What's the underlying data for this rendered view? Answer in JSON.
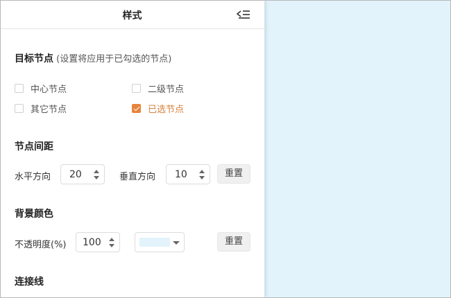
{
  "panel": {
    "title": "样式",
    "collapse_icon": "collapse-panel-icon"
  },
  "target": {
    "title": "目标节点",
    "hint": " (设置将应用于已勾选的节点)",
    "options": [
      {
        "label": "中心节点",
        "checked": false
      },
      {
        "label": "二级节点",
        "checked": false
      },
      {
        "label": "其它节点",
        "checked": false
      },
      {
        "label": "已选节点",
        "checked": true
      }
    ]
  },
  "spacing": {
    "title": "节点间距",
    "horizontal_label": "水平方向",
    "horizontal_value": "20",
    "vertical_label": "垂直方向",
    "vertical_value": "10",
    "reset_label": "重置"
  },
  "background": {
    "title": "背景颜色",
    "opacity_label": "不透明度(%)",
    "opacity_value": "100",
    "color": "#e2f3fc",
    "reset_label": "重置"
  },
  "connector": {
    "title": "连接线"
  },
  "colors": {
    "accent": "#e8843c",
    "canvas": "#e2f3fc"
  }
}
